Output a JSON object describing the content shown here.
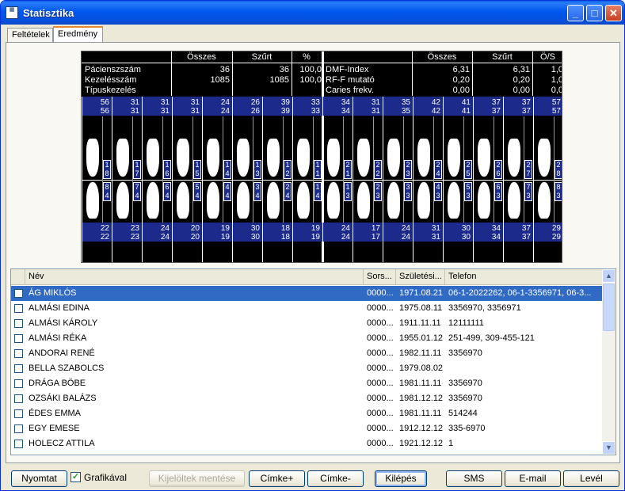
{
  "window": {
    "title": "Statisztika"
  },
  "tabs": [
    "Feltételek",
    "Eredmény"
  ],
  "chart": {
    "headers_left": [
      "Összes",
      "Szűrt",
      "%"
    ],
    "headers_right": [
      "Összes",
      "Szűrt",
      "Ö/S"
    ],
    "left_labels": [
      "Pácienszszám",
      "Kezelésszám",
      "Típuskezelés"
    ],
    "left_total": [
      "36",
      "1085",
      ""
    ],
    "left_filtered": [
      "36",
      "1085",
      ""
    ],
    "left_pct": [
      "100,0",
      "100,0",
      ""
    ],
    "right_labels": [
      "DMF-Index",
      "RF-F mutató",
      "Caries frekv."
    ],
    "right_total": [
      "6,31",
      "0,20",
      "0,00"
    ],
    "right_filtered": [
      "6,31",
      "0,20",
      "0,00"
    ],
    "right_ratio": [
      "1,0",
      "1,0",
      "0,0"
    ],
    "upper_counts": [
      [
        "56",
        "56"
      ],
      [
        "31",
        "31"
      ],
      [
        "31",
        "31"
      ],
      [
        "31",
        "31"
      ],
      [
        "24",
        "24"
      ],
      [
        "26",
        "26"
      ],
      [
        "39",
        "39"
      ],
      [
        "33",
        "33"
      ],
      [
        "34",
        "34"
      ],
      [
        "31",
        "31"
      ],
      [
        "35",
        "35"
      ],
      [
        "42",
        "42"
      ],
      [
        "41",
        "41"
      ],
      [
        "37",
        "37"
      ],
      [
        "37",
        "37"
      ],
      [
        "57",
        "57"
      ]
    ],
    "upper_numbers": [
      [
        "1",
        "8"
      ],
      [
        "1",
        "7"
      ],
      [
        "1",
        "6"
      ],
      [
        "1",
        "5"
      ],
      [
        "1",
        "4"
      ],
      [
        "1",
        "3"
      ],
      [
        "1",
        "2"
      ],
      [
        "1",
        "1"
      ],
      [
        "2",
        "1"
      ],
      [
        "2",
        "2"
      ],
      [
        "2",
        "3"
      ],
      [
        "2",
        "4"
      ],
      [
        "2",
        "5"
      ],
      [
        "2",
        "6"
      ],
      [
        "2",
        "7"
      ],
      [
        "2",
        "8"
      ]
    ],
    "lower_numbers": [
      [
        "8",
        "4"
      ],
      [
        "7",
        "4"
      ],
      [
        "6",
        "4"
      ],
      [
        "5",
        "4"
      ],
      [
        "4",
        "4"
      ],
      [
        "3",
        "4"
      ],
      [
        "2",
        "4"
      ],
      [
        "1",
        "4"
      ],
      [
        "1",
        "3"
      ],
      [
        "2",
        "3"
      ],
      [
        "3",
        "3"
      ],
      [
        "4",
        "3"
      ],
      [
        "5",
        "3"
      ],
      [
        "6",
        "3"
      ],
      [
        "7",
        "3"
      ],
      [
        "8",
        "3"
      ]
    ],
    "lower_counts": [
      [
        "22",
        "22"
      ],
      [
        "23",
        "23"
      ],
      [
        "24",
        "24"
      ],
      [
        "20",
        "20"
      ],
      [
        "19",
        "19"
      ],
      [
        "30",
        "30"
      ],
      [
        "18",
        "18"
      ],
      [
        "19",
        "19"
      ],
      [
        "24",
        "24"
      ],
      [
        "17",
        "17"
      ],
      [
        "24",
        "24"
      ],
      [
        "31",
        "31"
      ],
      [
        "30",
        "30"
      ],
      [
        "34",
        "34"
      ],
      [
        "37",
        "37"
      ],
      [
        "29",
        "29"
      ]
    ]
  },
  "list": {
    "columns": [
      "Név",
      "Sors...",
      "Születési...",
      "Telefon"
    ],
    "rows": [
      {
        "name": "ÁG MIKLÓS",
        "sors": "0000...",
        "birth": "1971.08.21",
        "phone": "06-1-2022262, 06-1-3356971, 06-3..."
      },
      {
        "name": "ALMÁSI EDINA",
        "sors": "0000...",
        "birth": "1975.08.11",
        "phone": "3356970, 3356971"
      },
      {
        "name": "ALMÁSI KÁROLY",
        "sors": "0000...",
        "birth": "1911.11.11",
        "phone": "12111111"
      },
      {
        "name": "ALMÁSI RÉKA",
        "sors": "0000...",
        "birth": "1955.01.12",
        "phone": "251-499, 309-455-121"
      },
      {
        "name": "ANDORAI RENÉ",
        "sors": "0000...",
        "birth": "1982.11.11",
        "phone": "3356970"
      },
      {
        "name": "BELLA SZABOLCS",
        "sors": "0000...",
        "birth": "1979.08.02",
        "phone": ""
      },
      {
        "name": "DRÁGA BÖBE",
        "sors": "0000...",
        "birth": "1981.11.11",
        "phone": "3356970"
      },
      {
        "name": "OZSÁKI BALÁZS",
        "sors": "0000...",
        "birth": "1981.12.12",
        "phone": "3356970"
      },
      {
        "name": "ÉDES EMMA",
        "sors": "0000...",
        "birth": "1981.11.11",
        "phone": "514244"
      },
      {
        "name": "EGY EMESE",
        "sors": "0000...",
        "birth": "1912.12.12",
        "phone": "335-6970"
      },
      {
        "name": "HOLECZ ATTILA",
        "sors": "0000...",
        "birth": "1921.12.12",
        "phone": "1"
      }
    ]
  },
  "buttons": {
    "print": "Nyomtat",
    "graphic": "Grafikával",
    "save_selected": "Kijelöltek mentése",
    "label_plus": "Címke+",
    "label_minus": "Címke-",
    "exit": "Kilépés",
    "sms": "SMS",
    "email": "E-mail",
    "letter": "Levél"
  }
}
